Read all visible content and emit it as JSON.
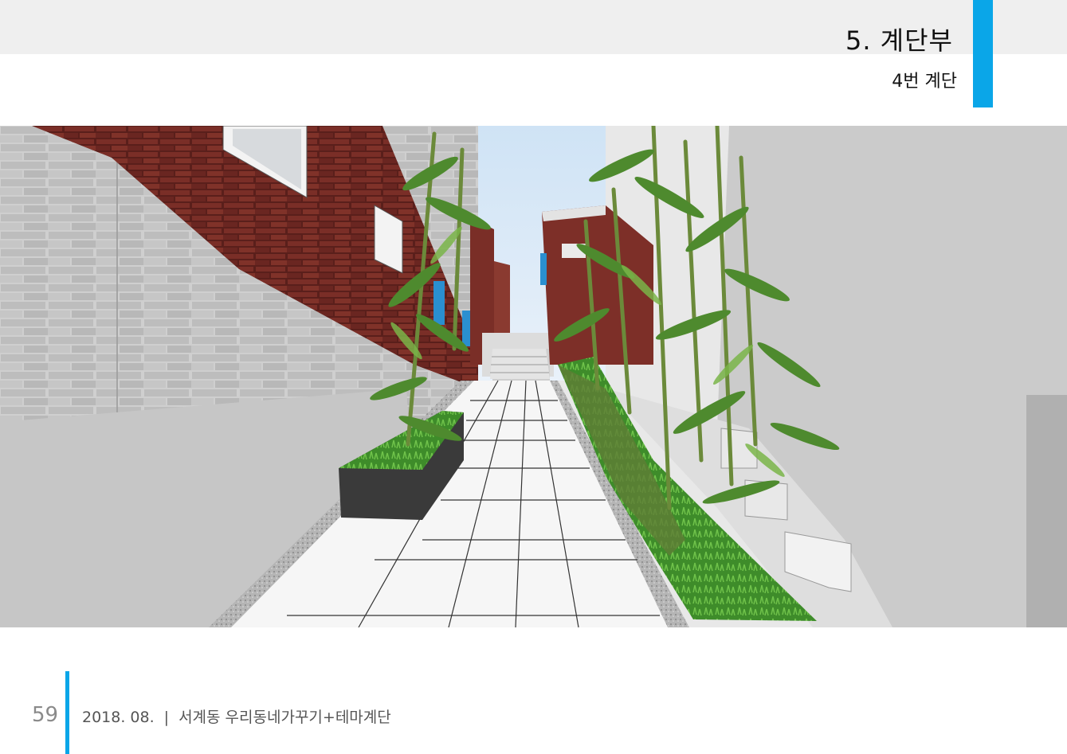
{
  "header": {
    "section_title": "5. 계단부",
    "subtitle": "4번 계단"
  },
  "render": {
    "description_icon": "alley-staircase-rendering"
  },
  "footer": {
    "page_number": "59",
    "date": "2018. 08.",
    "separator": "|",
    "project_title": "서계동 우리동네가꾸기+테마계단"
  },
  "colors": {
    "accent": "#0aa6e8",
    "header_band": "#efefef",
    "brick": "#6e2a24",
    "foliage": "#3f8a2a"
  }
}
